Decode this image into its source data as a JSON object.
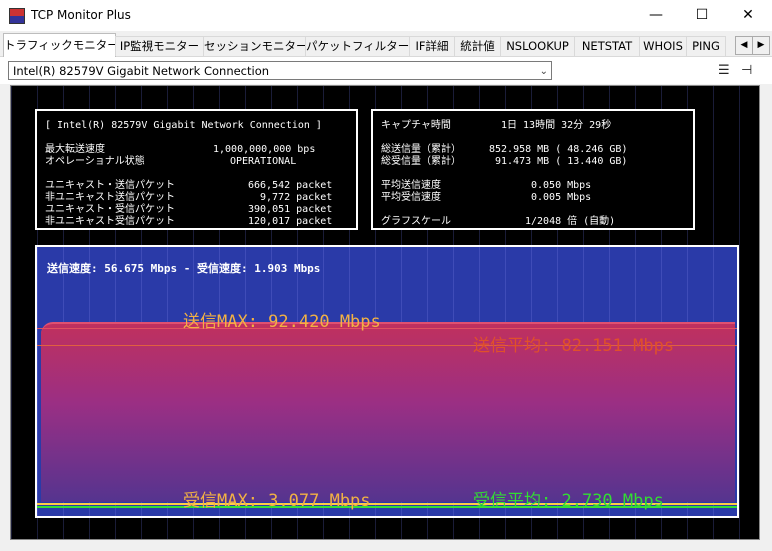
{
  "window": {
    "title": "TCP Monitor Plus",
    "minimize": "—",
    "maximize": "☐",
    "close": "✕"
  },
  "tabs": [
    "トラフィックモニター",
    "IP監視モニター",
    "セッションモニター",
    "パケットフィルター",
    "IF詳細",
    "統計値",
    "NSLOOKUP",
    "NETSTAT",
    "WHOIS",
    "PING"
  ],
  "tab_scroll": {
    "left": "◀",
    "right": "▶"
  },
  "adapter": {
    "selected": "Intel(R) 82579V Gigabit Network Connection",
    "arrow": "⌄"
  },
  "tool_icons": {
    "list": "☰",
    "pin": "⊣"
  },
  "left_panel": {
    "header": "[ Intel(R) 82579V Gigabit Network Connection ]",
    "rows": [
      {
        "label": "最大転送速度",
        "value": "1,000,000,000 bps"
      },
      {
        "label": "オペレーショナル状態",
        "value": "OPERATIONAL"
      },
      {
        "label": "ユニキャスト・送信パケット",
        "value": "666,542 packet"
      },
      {
        "label": "非ユニキャスト送信パケット",
        "value": "9,772 packet"
      },
      {
        "label": "ユニキャスト・受信パケット",
        "value": "390,051 packet"
      },
      {
        "label": "非ユニキャスト受信パケット",
        "value": "120,017 packet"
      }
    ]
  },
  "right_panel": {
    "capture_label": "キャプチャ時間",
    "capture_value": "1日 13時間 32分 29秒",
    "rows": [
      {
        "label": "総送信量（累計）",
        "value": "852.958 MB ( 48.246 GB)"
      },
      {
        "label": "総受信量（累計）",
        "value": "91.473 MB ( 13.440 GB)"
      },
      {
        "label": "平均送信速度",
        "value": "0.050 Mbps"
      },
      {
        "label": "平均受信速度",
        "value": "0.005 Mbps"
      }
    ],
    "scale_label": "グラフスケール",
    "scale_value": "1/2048 倍 (自動)"
  },
  "graph": {
    "speed_line": "送信速度:  56.675 Mbps  -  受信速度:   1.903 Mbps",
    "send_max": "送信MAX:   92.420 Mbps",
    "send_avg": "送信平均:   82.151 Mbps",
    "recv_max": "受信MAX:   3.077 Mbps",
    "recv_avg": "受信平均:   2.730 Mbps",
    "colors": {
      "send_max": "#f2b144",
      "send_avg": "#e0502a",
      "recv_max": "#f2b144",
      "recv_avg": "#33dd33",
      "fill_top": "#c0305e",
      "fill_bottom": "#55348f"
    }
  }
}
